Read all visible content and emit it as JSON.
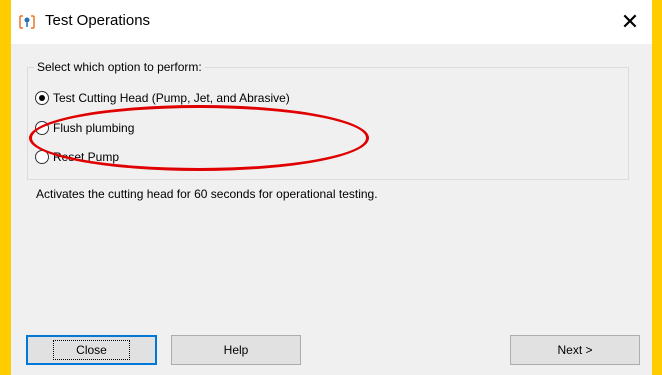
{
  "window": {
    "title": "Test Operations",
    "close_glyph": "✕"
  },
  "group": {
    "legend": "Select which option to perform:",
    "options": [
      {
        "label": "Test Cutting Head (Pump, Jet, and Abrasive)",
        "selected": true
      },
      {
        "label": "Flush plumbing",
        "selected": false
      },
      {
        "label": "Reset Pump",
        "selected": false
      }
    ]
  },
  "description": "Activates the cutting head for 60 seconds for operational testing.",
  "buttons": {
    "close": "Close",
    "help": "Help",
    "next": "Next >"
  },
  "colors": {
    "background_frame": "#ffcc00",
    "annotation": "#e00000",
    "default_button_border": "#0078d7"
  },
  "icons": {
    "app": "app-icon",
    "close": "close-icon"
  }
}
